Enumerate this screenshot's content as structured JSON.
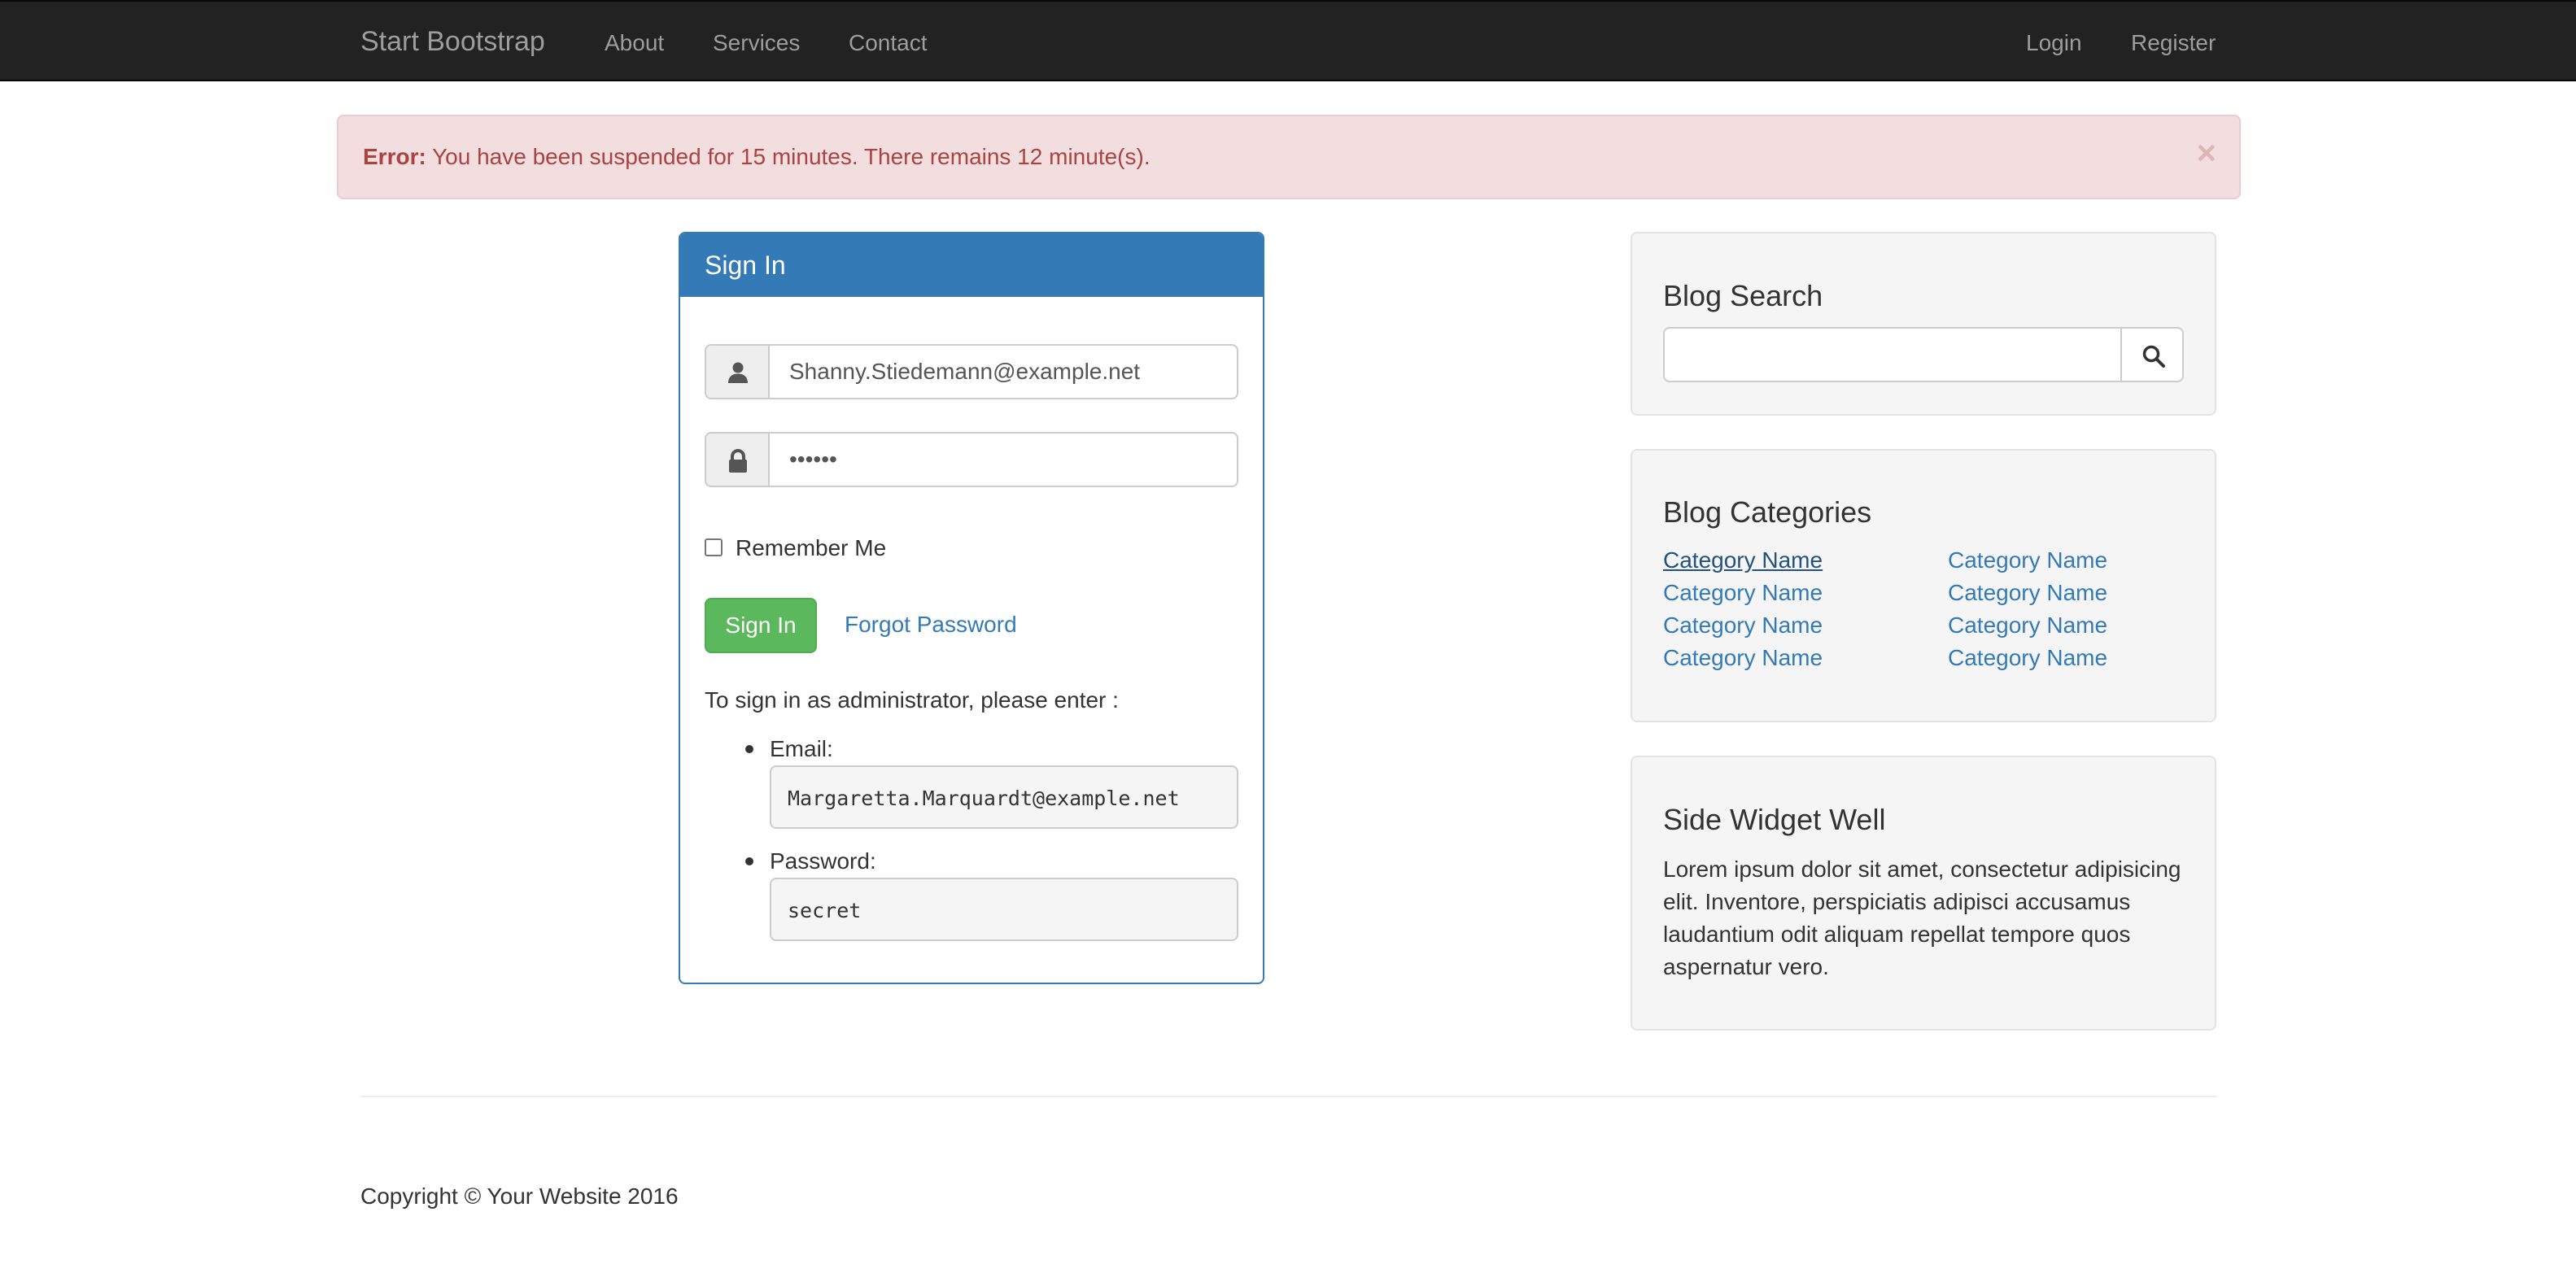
{
  "navbar": {
    "brand": "Start Bootstrap",
    "links": [
      "About",
      "Services",
      "Contact"
    ],
    "right_links": [
      "Login",
      "Register"
    ]
  },
  "alert": {
    "label": "Error:",
    "message": " You have been suspended for 15 minutes. There remains 12 minute(s).",
    "close": "×"
  },
  "signin": {
    "title": "Sign In",
    "email_value": "Shanny.Stiedemann@example.net",
    "password_value": "••••••",
    "remember_label": "Remember Me",
    "submit_label": "Sign In",
    "forgot_label": "Forgot Password",
    "admin_note": "To sign in as administrator, please enter :",
    "admin_email_label": "Email:",
    "admin_email": "Margaretta.Marquardt@example.net",
    "admin_password_label": "Password:",
    "admin_password": "secret"
  },
  "blog_search": {
    "title": "Blog Search",
    "value": ""
  },
  "blog_categories": {
    "title": "Blog Categories",
    "left": [
      "Category Name",
      "Category Name",
      "Category Name",
      "Category Name"
    ],
    "right": [
      "Category Name",
      "Category Name",
      "Category Name",
      "Category Name"
    ]
  },
  "side_widget": {
    "title": "Side Widget Well",
    "text": "Lorem ipsum dolor sit amet, consectetur adipisicing elit. Inventore, perspiciatis adipisci accusamus laudantium odit aliquam repellat tempore quos aspernatur vero."
  },
  "footer": {
    "copyright": "Copyright © Your Website 2016"
  },
  "icons": {
    "user": "user-icon",
    "lock": "lock-icon",
    "search": "search-icon",
    "close": "close-icon"
  },
  "colors": {
    "navbar_bg": "#222222",
    "primary": "#337ab7",
    "success": "#5cb85c",
    "danger_text": "#a94442",
    "danger_bg": "#f2dede"
  }
}
